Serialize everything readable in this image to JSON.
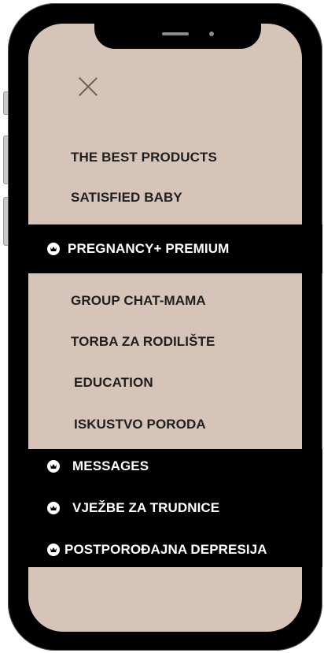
{
  "menu": {
    "items_light_top": [
      {
        "label": "THE BEST PRODUCTS"
      },
      {
        "label": "SATISFIED BABY"
      }
    ],
    "premium": {
      "label": "PREGNANCY+ PREMIUM",
      "icon": "crown-icon"
    },
    "items_light_mid": [
      {
        "label": "GROUP CHAT-MAMA"
      },
      {
        "label": "TORBA ZA RODILIŠTE"
      },
      {
        "label": "EDUCATION"
      },
      {
        "label": "ISKUSTVO PORODA"
      }
    ],
    "items_dark_bottom": [
      {
        "label": "MESSAGES",
        "icon": "crown-icon"
      },
      {
        "label": "VJEŽBE ZA TRUDNICE",
        "icon": "crown-icon"
      },
      {
        "label": "POSTPOROĐAJNA DEPRESIJA",
        "icon": "crown-icon"
      }
    ]
  },
  "colors": {
    "screen_bg": "#d5c4b7",
    "band_bg": "#000000",
    "text_dark": "#1f1f1f",
    "text_light": "#ffffff"
  }
}
